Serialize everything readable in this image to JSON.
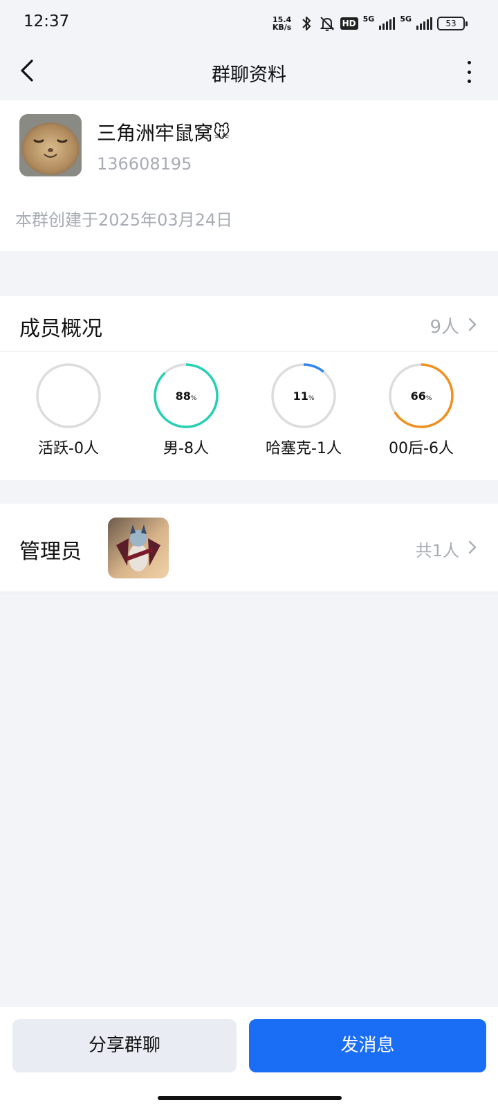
{
  "status_bar": {
    "time": "12:37",
    "net_speed_value": "15.4",
    "net_speed_unit": "KB/s",
    "hd_badge": "HD",
    "signal1": "5G",
    "signal2": "5G",
    "battery": "53",
    "icons": [
      "bluetooth-icon",
      "mute-bell-icon",
      "hd-volte-icon",
      "signal-5g-icon",
      "signal-5g-icon",
      "battery-icon"
    ]
  },
  "nav": {
    "title": "群聊资料",
    "back_icon": "back-arrow-icon",
    "more_icon": "more-vertical-icon"
  },
  "group": {
    "name": "三角洲牢鼠窝",
    "name_emoji": "🐭",
    "id": "136608195",
    "created": "本群创建于2025年03月24日"
  },
  "members": {
    "title": "成员概况",
    "count": "9人",
    "stats": [
      {
        "label": "活跃-0人",
        "percent": 0,
        "percent_text": "",
        "color": "#d9d9d9"
      },
      {
        "label": "男-8人",
        "percent": 88,
        "percent_text": "88",
        "color": "#26d0b4"
      },
      {
        "label": "哈塞克-1人",
        "percent": 11,
        "percent_text": "11",
        "color": "#2f86f0"
      },
      {
        "label": "00后-6人",
        "percent": 66,
        "percent_text": "66",
        "color": "#f0901e"
      }
    ],
    "percent_unit": "%"
  },
  "admin": {
    "title": "管理员",
    "count": "共1人"
  },
  "actions": {
    "share": "分享群聊",
    "send": "发消息"
  },
  "colors": {
    "accent": "#1a6ef5",
    "background": "#f2f4f8",
    "secondary_text": "#a8acb4"
  }
}
